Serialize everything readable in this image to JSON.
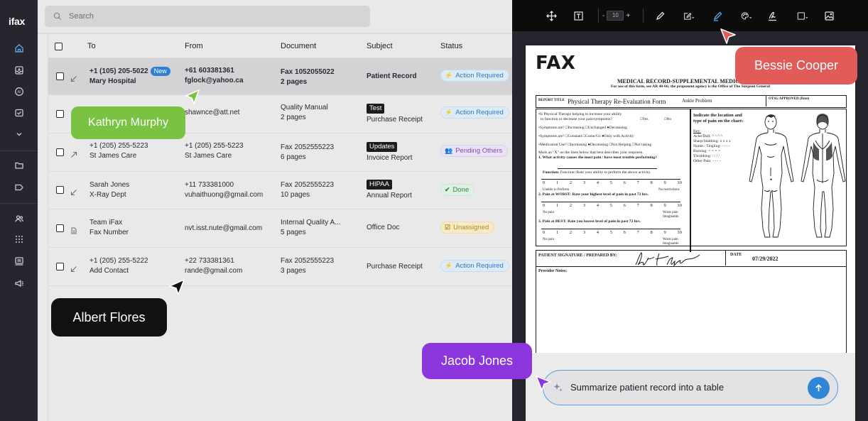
{
  "sidebar": {
    "logo": "ifax",
    "icons": [
      "home-icon",
      "inbox-icon",
      "ai-icon",
      "mail-icon",
      "chevron-down-icon",
      "folder-icon",
      "tag-icon",
      "contacts-icon",
      "apps-icon",
      "fax-machine-icon",
      "megaphone-icon"
    ]
  },
  "search": {
    "placeholder": "Search"
  },
  "table": {
    "columns": {
      "to": "To",
      "from": "From",
      "document": "Document",
      "subject": "Subject",
      "status": "Status"
    },
    "rows": [
      {
        "direction": "incoming",
        "to_line1": "+1 (105) 205-5022",
        "new_badge": "New",
        "to_line2": "Mary Hospital",
        "from_line1": "+61 603381361",
        "from_line2": "fglock@yahoo.ca",
        "doc_line1": "Fax 1052055022",
        "doc_line2": "2 pages",
        "subject_tag": "",
        "subject": "Patient Record",
        "status": "Action Required",
        "status_type": "action"
      },
      {
        "direction": "incoming",
        "to_line1": "",
        "to_line2": "",
        "from_line1": "shawnce@att.net",
        "from_line2": "",
        "doc_line1": "Quality Manual",
        "doc_line2": "2 pages",
        "subject_tag": "Test",
        "subject": "Purchase Receipt",
        "status": "Action Required",
        "status_type": "action"
      },
      {
        "direction": "outgoing",
        "to_line1": "+1 (205) 255-5223",
        "to_line2": "St James Care",
        "from_line1": "+1 (205) 255-5223",
        "from_line2": "St James Care",
        "doc_line1": "Fax 2052555223",
        "doc_line2": "6 pages",
        "subject_tag": "Updates",
        "subject": "Invoice Report",
        "status": "Pending Others",
        "status_type": "pending"
      },
      {
        "direction": "incoming",
        "to_line1": "Sarah Jones",
        "to_line2": "X-Ray Dept",
        "from_line1": "+11 733381000",
        "from_line2": "vuhaithuong@gmail.com",
        "doc_line1": "Fax 2052555223",
        "doc_line2": "10 pages",
        "subject_tag": "HIPAA",
        "subject": "Annual Report",
        "status": "Done",
        "status_type": "done"
      },
      {
        "direction": "document",
        "to_line1": "Team iFax",
        "to_line2": "Fax Number",
        "from_line1": "nvt.isst.nute@gmail.com",
        "from_line2": "",
        "doc_line1": "Internal Quality A...",
        "doc_line2": "5 pages",
        "subject_tag": "",
        "subject": "Office Doc",
        "status": "Unassigned",
        "status_type": "unassigned"
      },
      {
        "direction": "incoming",
        "to_line1": "+1 (205) 255-5222",
        "to_line2": "Add Contact",
        "from_line1": "+22 733381361",
        "from_line2": "rande@gmail.com",
        "doc_line1": "Fax 2052555223",
        "doc_line2": "3 pages",
        "subject_tag": "",
        "subject": "Purchase Receipt",
        "status": "Action Required",
        "status_type": "action"
      }
    ]
  },
  "viewer": {
    "toolbar": {
      "zoom_minus": "-",
      "zoom_value": "10",
      "zoom_plus": "+"
    },
    "document": {
      "title": "FAX",
      "form_heading": "MEDICAL RECORD-SUPPLEMENTAL MEDICAL DATA",
      "form_subheading": "For use of this form, see AR 40-66; the proponent agency is the Office of The Surgeon General",
      "report_title_label": "REPORT TITLE",
      "report_title": "Physical Therapy Re-Evaluation Form",
      "report_sub": "Ankle Problem",
      "otsg_label": "OTSG APPROVED (Date)",
      "q_helping": "•Is Physical Therapy helping to increase your ability",
      "q_helping2": "to function or decrease your pain/symptoms?",
      "opt_yes": "□Yes",
      "opt_no": "□No",
      "q_symptoms1": "•Symptoms are?  □Increasing  □Unchanged  ●Decreasing",
      "q_symptoms2": "•Symptoms are?  □Constant  □Come/Go  ●Only with Activity",
      "q_medication": "•Medication Use? □Increasing  ●Decreasing  □Not Helping  □Not taking",
      "q_mark": "Mark an \"X\" on the lines below that best describes your response.",
      "q1": "1. What activity causes the most pain / have most trouble performing?",
      "q_function": "Function: Rate your ability to perform the above activity.",
      "scale_nums": [
        "0",
        "1",
        "2",
        "3",
        "4",
        "5",
        "6",
        "7",
        "8",
        "9",
        "10"
      ],
      "scale_fn_left": "Unable to Perform",
      "scale_fn_right": "No restrictions",
      "q2": "2. Pain at WORST: Rate your highest level of pain in past 72 hrs.",
      "scale_pain_left": "No pain",
      "scale_pain_right": "Worst pain",
      "scale_pain_right2": "Imaginable",
      "q3": "3. Pain at BEST:  Rate you lowest level of pain in past 72 hrs.",
      "chart_heading": "Indicate the location and",
      "chart_heading2": "type of pain on the chart:",
      "key_label": "Key:",
      "key_items": [
        "Ache/Dull: ^ ^ ^ ^",
        "Sharp/Stabbing: x x x x",
        "Numb / Tingling: - - - -",
        "Burning: = = = =",
        "Throbbing: / / / /",
        "Other Pain: - - - -"
      ],
      "sig_label": "PATIENT SIGNATURE / PREPARED BY:",
      "date_label": "DATE",
      "date_value": "07/29/2022",
      "provider_notes": "Provider Notes:"
    },
    "chat": {
      "value": "Summarize patient record into a table"
    }
  },
  "collaborators": [
    {
      "name": "Kathryn Murphy",
      "color": "#79c242"
    },
    {
      "name": "Albert Flores",
      "color": "#111112"
    },
    {
      "name": "Jacob Jones",
      "color": "#8b35dc"
    },
    {
      "name": "Bessie Cooper",
      "color": "#e15b58"
    }
  ]
}
